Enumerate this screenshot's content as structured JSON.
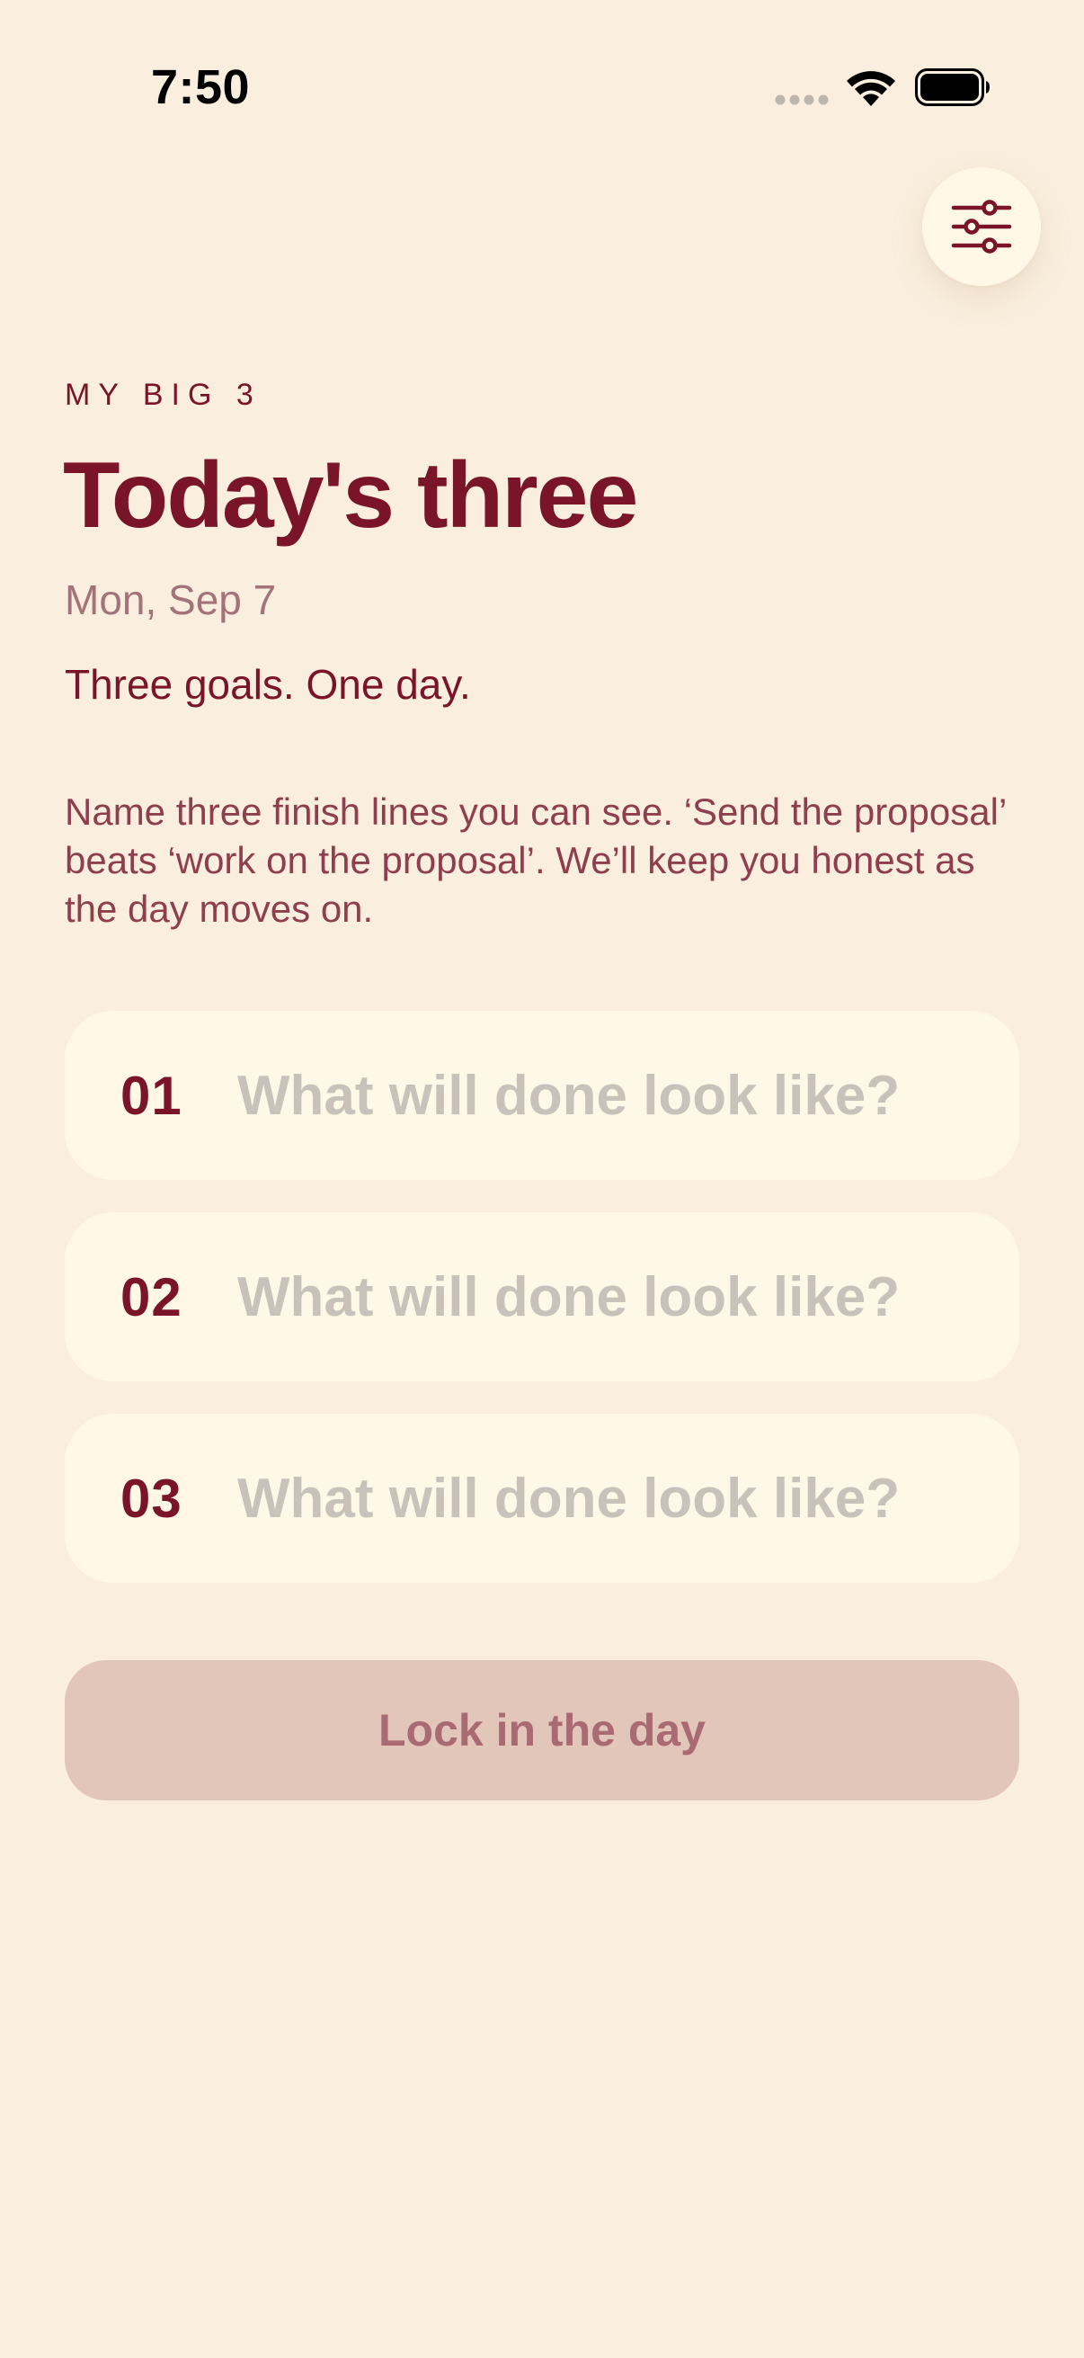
{
  "status_bar": {
    "time": "7:50",
    "signal_icon": "cellular-signal-dots-icon",
    "wifi_icon": "wifi-icon",
    "battery_icon": "battery-full-icon"
  },
  "header": {
    "settings_icon": "sliders-icon",
    "eyebrow": "MY BIG 3",
    "title": "Today's three",
    "date": "Mon, Sep 7",
    "tagline": "Three goals. One day.",
    "description": "Name three finish lines you can see. ‘Send the proposal’ beats ‘work on the proposal’. We’ll keep you honest as the day moves on."
  },
  "goals": [
    {
      "number": "01",
      "value": "",
      "placeholder": "What will done look like?"
    },
    {
      "number": "02",
      "value": "",
      "placeholder": "What will done look like?"
    },
    {
      "number": "03",
      "value": "",
      "placeholder": "What will done look like?"
    }
  ],
  "actions": {
    "lock_label": "Lock in the day"
  },
  "colors": {
    "background": "#FAEFDF",
    "card": "#FFF8E7",
    "accent": "#7A1428",
    "muted_text": "#A4737A",
    "placeholder": "#C8C2BA",
    "button_disabled_bg": "#E2C6BA",
    "button_disabled_text": "#AA6A72"
  }
}
